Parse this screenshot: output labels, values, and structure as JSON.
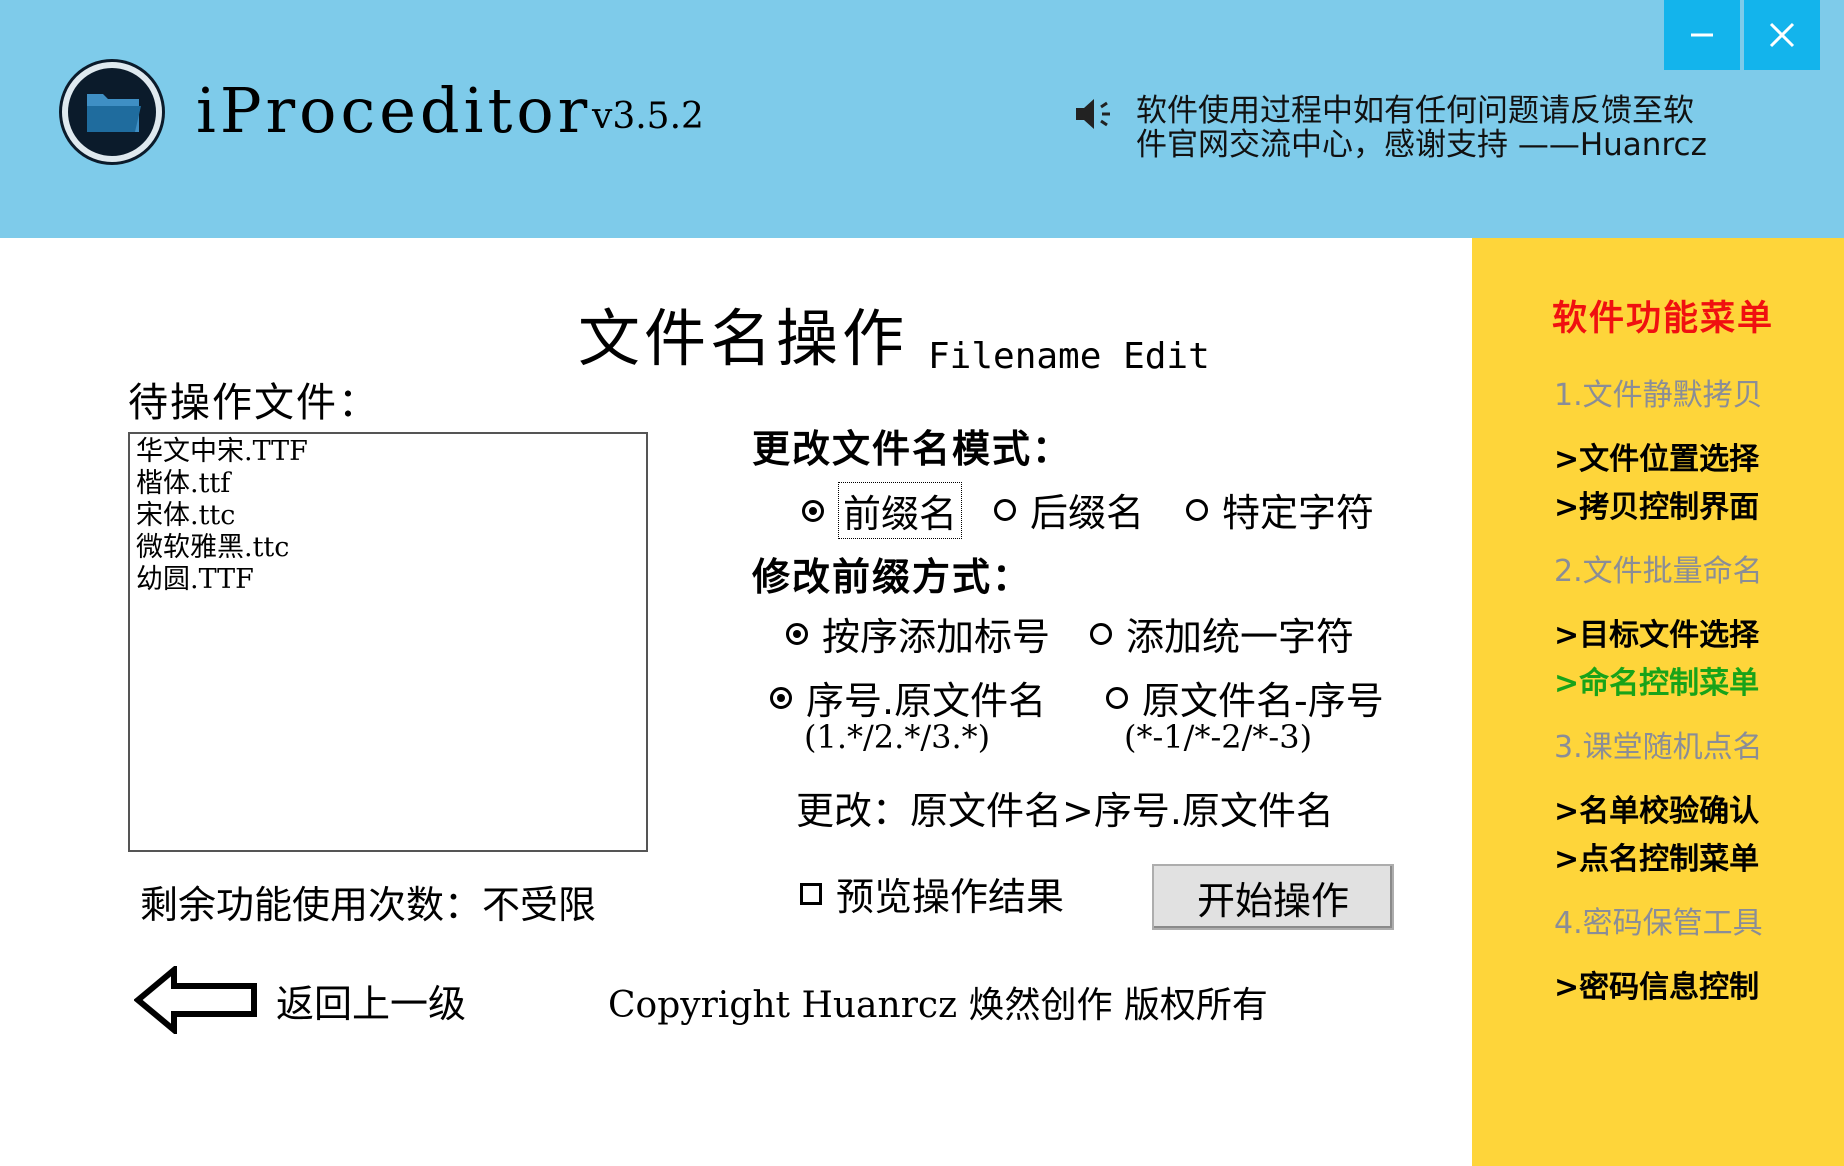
{
  "header": {
    "app_name": "iProceditor",
    "version": "v3.5.2",
    "notice": "软件使用过程中如有任何问题请反馈至软件官网交流中心，感谢支持 ——Huanrcz",
    "speaker_icon": "speaker-icon",
    "minimize_icon": "minimize-icon",
    "close_icon": "close-icon",
    "bg_color": "#7ecbea",
    "window_button_color": "#13b4ec"
  },
  "page": {
    "title": "文件名操作",
    "subtitle": "Filename Edit",
    "files_label": "待操作文件：",
    "files": [
      "华文中宋.TTF",
      "楷体.ttf",
      "宋体.ttc",
      "微软雅黑.ttc",
      "幼圆.TTF"
    ],
    "remaining": "剩余功能使用次数：不受限",
    "mode_label": "更改文件名模式：",
    "modes": [
      "前缀名",
      "后缀名",
      "特定字符"
    ],
    "selected_mode": "前缀名",
    "prefix_label": "修改前缀方式：",
    "prefix_methods": [
      "按序添加标号",
      "添加统一字符"
    ],
    "selected_prefix_method": "按序添加标号",
    "number_formats": [
      {
        "label": "序号.原文件名",
        "example": "(1.*/2.*/3.*)"
      },
      {
        "label": "原文件名-序号",
        "example": "(*-1/*-2/*-3)"
      }
    ],
    "selected_number_format": "序号.原文件名",
    "change_text": "更改：原文件名>序号.原文件名",
    "preview_label": "预览操作结果",
    "preview_checked": false,
    "start_button": "开始操作",
    "back_label": "返回上一级",
    "back_icon": "left-arrow-icon",
    "copyright_latin": "Copyright Huanrcz",
    "copyright_cn": "焕然创作 版权所有"
  },
  "sidebar": {
    "title": "软件功能菜单",
    "bg_color": "#fed53a",
    "title_color": "#f01010",
    "active_color": "#19a319",
    "items": [
      {
        "label": "1.文件静默拷贝",
        "type": "section"
      },
      {
        "label": ">文件位置选择",
        "type": "sub"
      },
      {
        "label": ">拷贝控制界面",
        "type": "sub"
      },
      {
        "label": "2.文件批量命名",
        "type": "section"
      },
      {
        "label": ">目标文件选择",
        "type": "sub"
      },
      {
        "label": ">命名控制菜单",
        "type": "active"
      },
      {
        "label": "3.课堂随机点名",
        "type": "section"
      },
      {
        "label": ">名单校验确认",
        "type": "sub"
      },
      {
        "label": ">点名控制菜单",
        "type": "sub"
      },
      {
        "label": "4.密码保管工具",
        "type": "section"
      },
      {
        "label": ">密码信息控制",
        "type": "sub"
      }
    ]
  }
}
